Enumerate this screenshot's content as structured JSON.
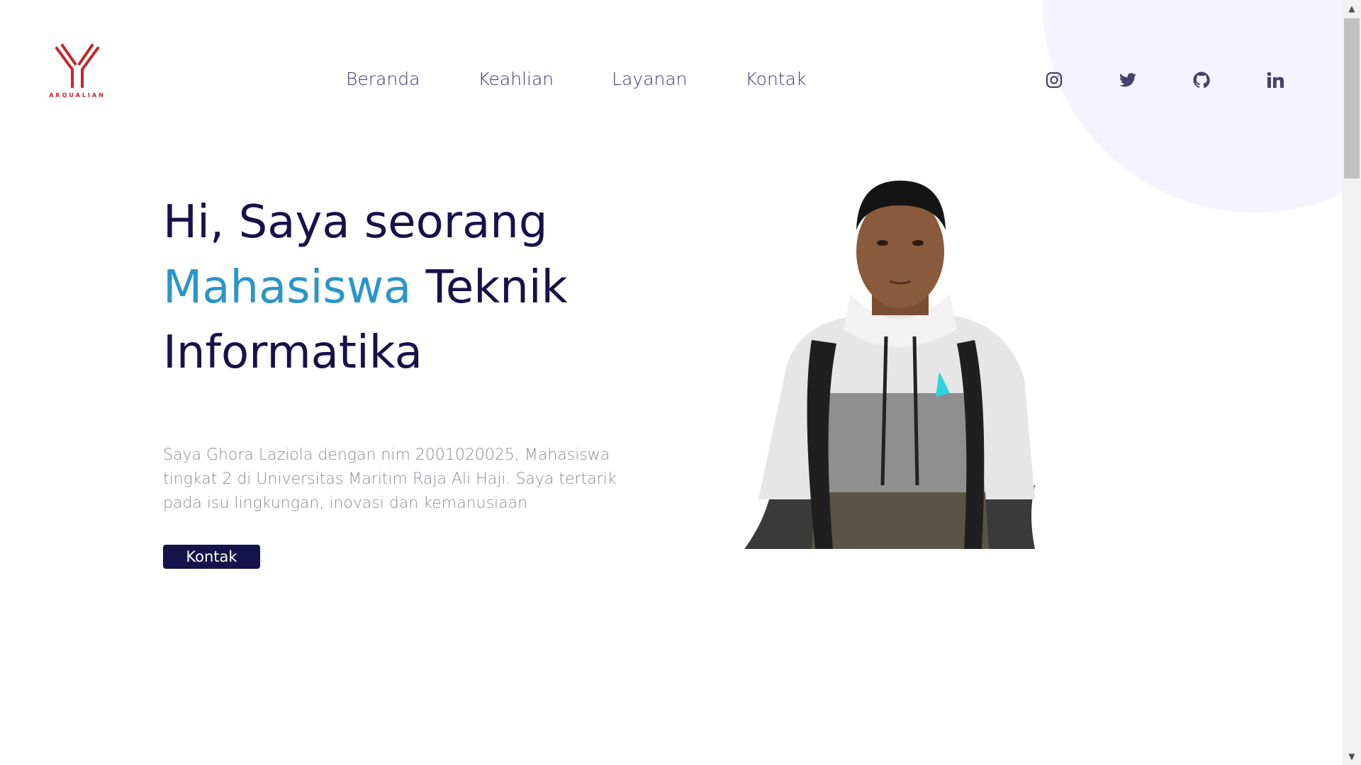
{
  "brand": {
    "name": "ARQUALIAN",
    "color": "#c1272d"
  },
  "nav": {
    "items": [
      {
        "label": "Beranda"
      },
      {
        "label": "Keahlian"
      },
      {
        "label": "Layanan"
      },
      {
        "label": "Kontak"
      }
    ]
  },
  "social": [
    {
      "icon": "instagram-icon"
    },
    {
      "icon": "twitter-icon"
    },
    {
      "icon": "github-icon"
    },
    {
      "icon": "linkedin-icon"
    }
  ],
  "hero": {
    "title_part1": "Hi, Saya seorang",
    "title_accent": "Mahasiswa",
    "title_part2": "Teknik Informatika",
    "description": "Saya Ghora Laziola dengan nim 2001020025, Mahasiswa tingkat 2 di Universitas Maritim Raja Ali Haji. Saya tertarik pada isu lingkungan, inovasi dan kemanusiaan",
    "button_label": "Kontak"
  },
  "colors": {
    "primary": "#16124a",
    "accent": "#2b95c9",
    "nav_text": "#3d3b6b",
    "body_text": "#8b8a94"
  }
}
